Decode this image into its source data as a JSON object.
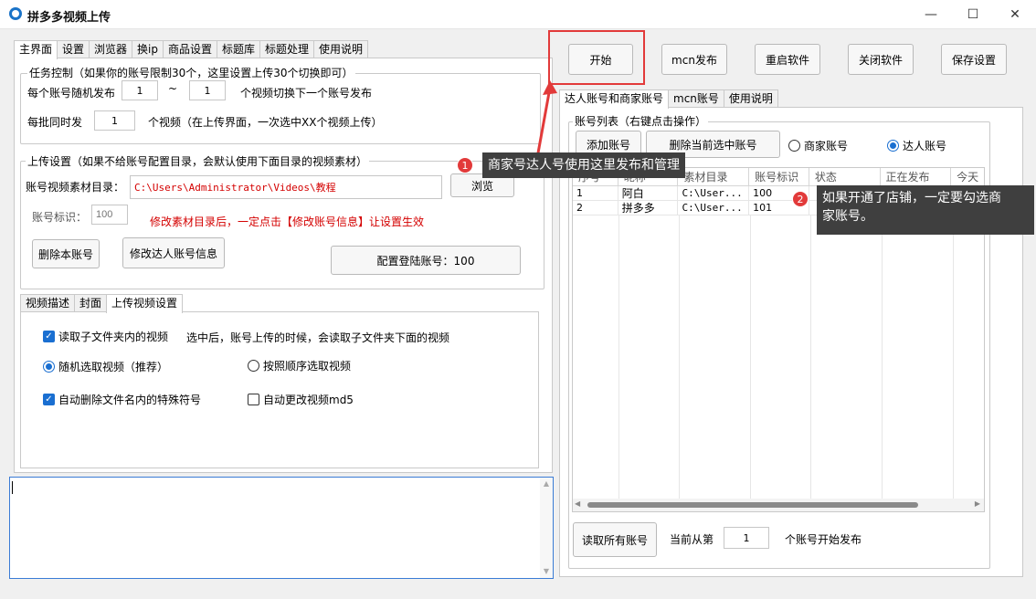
{
  "window": {
    "title": "拼多多视频上传",
    "minimize": "—",
    "maximize": "☐",
    "close": "✕"
  },
  "left_tabs": [
    "主界面",
    "设置",
    "浏览器",
    "换ip",
    "商品设置",
    "标题库",
    "标题处理",
    "使用说明"
  ],
  "task": {
    "group_title": "任务控制（如果你的账号限制30个，这里设置上传30个切换即可）",
    "row1_label": "每个账号随机发布",
    "row1_min": "1",
    "row1_sep": "~",
    "row1_max": "1",
    "row1_suffix": "个视频切换下一个账号发布",
    "row2_label": "每批同时发",
    "row2_value": "1",
    "row2_suffix": "个视频（在上传界面，一次选中XX个视频上传）"
  },
  "upload": {
    "group_title": "上传设置（如果不给账号配置目录，会默认使用下面目录的视频素材）",
    "dir_label": "账号视频素材目录：",
    "dir_value": "C:\\Users\\Administrator\\Videos\\教程",
    "browse_label": "浏览",
    "id_label": "账号标识：",
    "id_placeholder": "100",
    "note": "修改素材目录后，一定点击【修改账号信息】让设置生效",
    "delete_btn": "删除本账号",
    "modify_btn": "修改达人账号信息",
    "config_btn": "配置登陆账号：100"
  },
  "sub_tabs": [
    "视频描述",
    "封面",
    "上传视频设置"
  ],
  "video_settings": {
    "opt1": "读取子文件夹内的视频",
    "opt1_desc": "选中后，账号上传的时候，会读取子文件夹下面的视频",
    "opt2": "随机选取视频（推荐）",
    "opt3": "按照顺序选取视频",
    "opt4": "自动删除文件名内的特殊符号",
    "opt5": "自动更改视频md5"
  },
  "top_buttons": {
    "start": "开始",
    "mcn": "mcn发布",
    "restart": "重启软件",
    "close": "关闭软件",
    "save": "保存设置"
  },
  "right_tabs": [
    "达人账号和商家账号",
    "mcn账号",
    "使用说明"
  ],
  "accounts": {
    "group_title": "账号列表（右键点击操作）",
    "add_btn": "添加账号",
    "delete_btn": "删除当前选中账号",
    "merchant_label": "商家账号",
    "talent_label": "达人账号",
    "columns": [
      "序号",
      "昵称",
      "素材目录",
      "账号标识",
      "状态",
      "正在发布",
      "今天"
    ],
    "rows": [
      {
        "no": "1",
        "name": "阿白",
        "dir": "C:\\User...",
        "id": "100"
      },
      {
        "no": "2",
        "name": "拼多多",
        "dir": "C:\\User...",
        "id": "101"
      }
    ],
    "read_btn": "读取所有账号",
    "current_label": "当前从第",
    "current_value": "1",
    "current_suffix": "个账号开始发布"
  },
  "callouts": {
    "c1_num": "1",
    "c1_text": "商家号达人号使用这里发布和管理",
    "c2_num": "2",
    "c2_text_1": "如果开通了店铺，一定要勾选商",
    "c2_text_2": "家账号。"
  },
  "colors": {
    "accent": "#1a6fd1",
    "callout_bg": "#3f3f3f",
    "badge": "#e23a3a",
    "note_red": "#d40000"
  }
}
